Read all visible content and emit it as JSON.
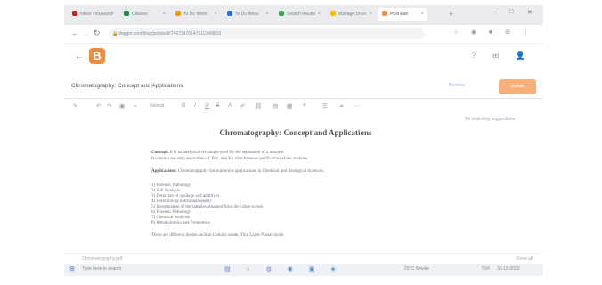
{
  "browser": {
    "tabs": [
      {
        "label": "Inbox - mukesh2",
        "color": "#c5221f"
      },
      {
        "label": "Classes",
        "color": "#1e8e3e"
      },
      {
        "label": "To Do Items",
        "color": "#f29900"
      },
      {
        "label": "To Do Items",
        "color": "#1a73e8"
      },
      {
        "label": "Search results",
        "color": "#34a853"
      },
      {
        "label": "Manage Drive",
        "color": "#fbbc04"
      },
      {
        "label": "Post Edit",
        "color": "#f28b3a",
        "active": true
      }
    ],
    "new_tab_icon": "plus-icon",
    "url": "blogger.com/blog/post/edit/7467347014751134/8833",
    "window_controls": [
      "minimize-icon",
      "maximize-icon",
      "close-icon"
    ]
  },
  "header": {
    "back_icon": "back-arrow-icon",
    "logo_letter": "B",
    "logo_color": "#f28b3a",
    "right_icons": [
      "help-icon",
      "apps-icon",
      "avatar-icon"
    ]
  },
  "post": {
    "title": "Chromatography: Concept and Applications",
    "preview_label": "Preview",
    "publish_label": "Update"
  },
  "toolbar": {
    "font_label": "Normal",
    "icons": [
      "pencil-icon",
      "undo-icon",
      "redo-icon",
      "save-icon",
      "link-icon",
      "bold-icon",
      "italic-icon",
      "underline-icon",
      "strikethrough-icon",
      "text-color-icon",
      "highlight-icon",
      "link-insert-icon",
      "image-icon",
      "video-icon",
      "align-icon",
      "list-icon",
      "more-icon"
    ]
  },
  "sidebar": {
    "label": "No matching suggestions"
  },
  "document": {
    "heading": "Chromatography: Concept and Applications",
    "concept_label": "Concept:",
    "concept_text": "It is an analytical technique used for the separation of a mixture.",
    "concept_line2": "It consists not only separation of. But, also for simultaneous purification of the analytes.",
    "applications_label": "Applications:",
    "applications_text": "Chromatography has numerous applications in Chemical and Biological Sciences.",
    "list": [
      "1) Forensic Pathology",
      "2) Soil Analysis",
      "3) Detection of spoilage and additives",
      "4) Determining nutritional quality",
      "5) Investigation of the samples obtained from the crime scenes",
      "6) Forensic Pathology",
      "7) Chemical Analysis",
      "8) Metabolomics and Proteomics"
    ],
    "footer_text": "There are different modes such as Column mode, Thin Layer Planar mode."
  },
  "downloads": {
    "item": "Chromatography.pdf",
    "show_all": "Show all"
  },
  "taskbar": {
    "search_placeholder": "Type here to search",
    "weather": "25°C Smoke",
    "time": "7:04",
    "date": "30-10-2023"
  }
}
